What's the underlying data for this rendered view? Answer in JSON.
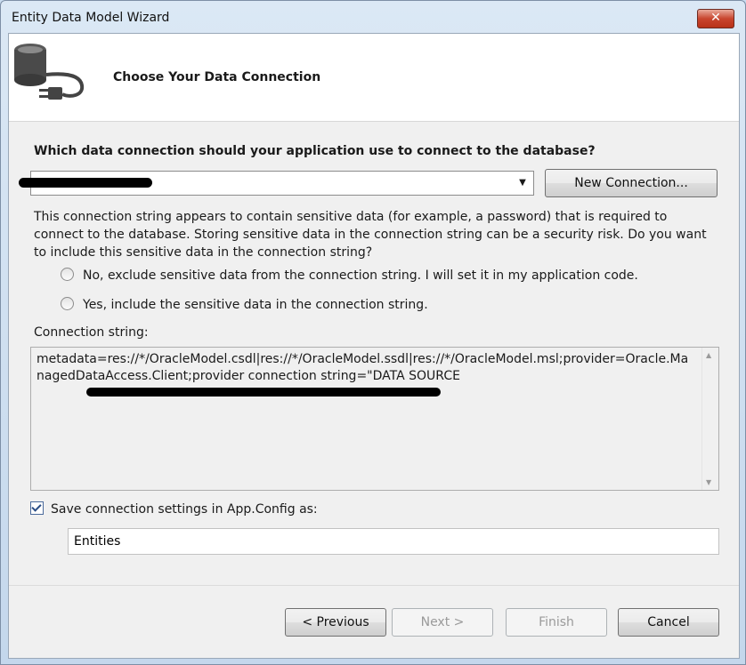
{
  "window": {
    "title": "Entity Data Model Wizard",
    "close_glyph": "✕"
  },
  "header": {
    "title": "Choose Your Data Connection",
    "icon": "database-plug-icon"
  },
  "question": "Which data connection should your application use to connect to the database?",
  "connection_combo": {
    "selected": "",
    "arrow_glyph": "▼",
    "redacted": true
  },
  "new_connection_label": "New Connection...",
  "warning_text": "This connection string appears to contain sensitive data (for example, a password) that is required to connect to the database. Storing sensitive data in the connection string can be a security risk. Do you want to include this sensitive data in the connection string?",
  "options": [
    {
      "label": "No, exclude sensitive data from the connection string. I will set it in my application code.",
      "selected": false
    },
    {
      "label": "Yes, include the sensitive data in the connection string.",
      "selected": false
    }
  ],
  "connection_string": {
    "label": "Connection string:",
    "value": "metadata=res://*/OracleModel.csdl|res://*/OracleModel.ssdl|res://*/OracleModel.msl;provider=Oracle.ManagedDataAccess.Client;provider connection string=\"DATA SOURCE"
  },
  "save_settings": {
    "label": "Save connection settings in App.Config as:",
    "checked": true,
    "value": "Entities"
  },
  "buttons": {
    "previous": "< Previous",
    "next": "Next >",
    "finish": "Finish",
    "cancel": "Cancel"
  }
}
